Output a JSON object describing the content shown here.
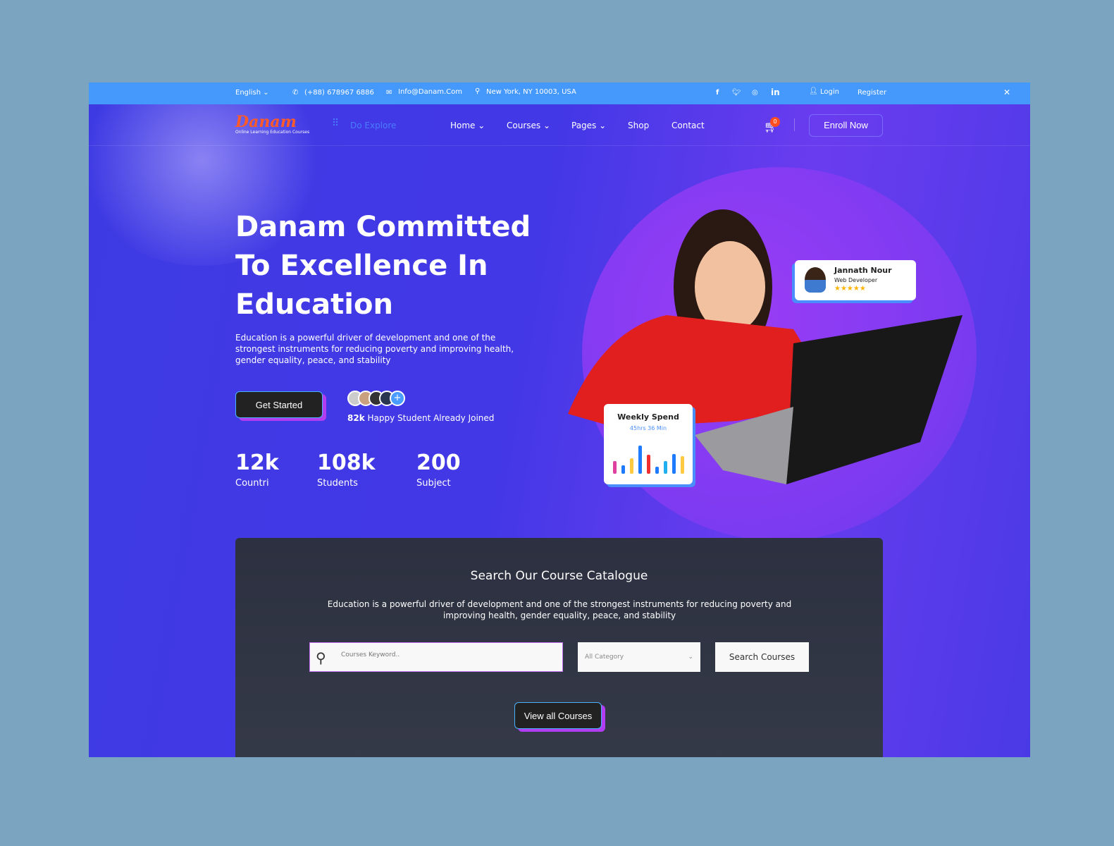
{
  "topbar": {
    "language": "English",
    "phone": "(+88) 678967 6886",
    "email": "Info@Danam.Com",
    "address": "New York, NY 10003, USA",
    "login": "Login",
    "register": "Register"
  },
  "nav": {
    "logo": "Danam",
    "tagline": "Online Learning Education Courses",
    "explore": "Do Explore",
    "items": [
      "Home",
      "Courses",
      "Pages",
      "Shop",
      "Contact"
    ],
    "cart_count": "0",
    "enroll": "Enroll Now"
  },
  "hero": {
    "title": "Danam Committed To Excellence In Education",
    "description": "Education is a powerful driver of development and one of the strongest instruments for reducing poverty and improving health, gender equality, peace, and stability",
    "cta": "Get Started",
    "joined_count": "82k",
    "joined_text": "Happy Student Already Joined",
    "stats": [
      {
        "value": "12k",
        "label": "Countri"
      },
      {
        "value": "108k",
        "label": "Students"
      },
      {
        "value": "200",
        "label": "Subject"
      }
    ]
  },
  "profile_card": {
    "name": "Jannath Nour",
    "role": "Web Developer",
    "rating": 5
  },
  "weekly_card": {
    "title": "Weekly Spend",
    "subtitle": "45hrs 36 Min",
    "bars": [
      {
        "h": 0.45,
        "c": "#e040a0"
      },
      {
        "h": 0.3,
        "c": "#1e7bff"
      },
      {
        "h": 0.55,
        "c": "#ffc940"
      },
      {
        "h": 1,
        "c": "#1e7bff"
      },
      {
        "h": 0.68,
        "c": "#f03030"
      },
      {
        "h": 0.24,
        "c": "#1e7bff"
      },
      {
        "h": 0.45,
        "c": "#20b0f0"
      },
      {
        "h": 0.7,
        "c": "#1e7bff"
      },
      {
        "h": 0.62,
        "c": "#ffc940"
      }
    ]
  },
  "search": {
    "title": "Search Our Course Catalogue",
    "description": "Education is a powerful driver of development and one of the strongest instruments for reducing poverty and improving health, gender equality, peace, and stability",
    "placeholder": "Courses Keyword..",
    "category": "All Category",
    "button": "Search Courses",
    "view_all": "View all Courses"
  },
  "colors": {
    "topbar": "#4599fd",
    "accent": "#ff5a2a",
    "hero": "#4338e6"
  }
}
